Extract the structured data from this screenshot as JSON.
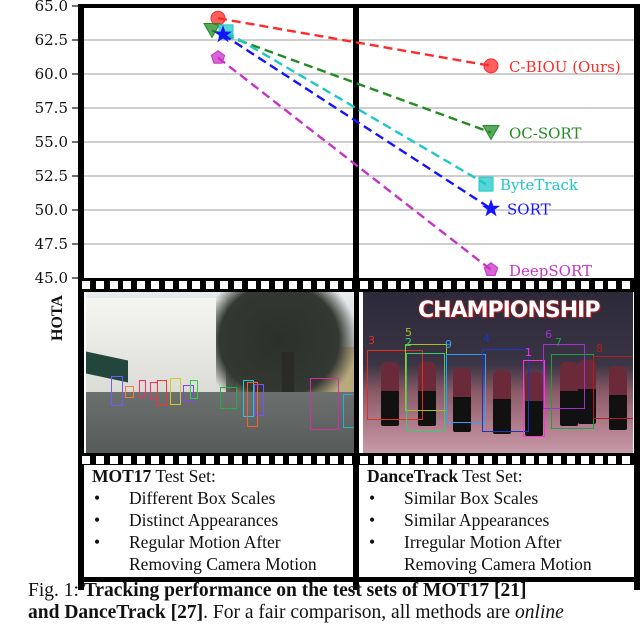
{
  "chart_data": {
    "type": "line",
    "title": "",
    "xlabel": "",
    "ylabel": "HOTA",
    "ylim": [
      45.0,
      65.0
    ],
    "yticks": [
      "65.0",
      "62.5",
      "60.0",
      "57.5",
      "55.0",
      "52.5",
      "50.0",
      "47.5",
      "45.0"
    ],
    "grid": true,
    "categories": [
      "MOT17",
      "DanceTrack"
    ],
    "series": [
      {
        "name": "C-BIOU (Ours)",
        "color": "#ff2a2a",
        "marker": "circle",
        "values": [
          64.1,
          60.6
        ]
      },
      {
        "name": "OC-SORT",
        "color": "#228b22",
        "marker": "triangle-down",
        "values": [
          63.2,
          55.7
        ]
      },
      {
        "name": "ByteTrack",
        "color": "#1fc8c8",
        "marker": "square",
        "values": [
          63.1,
          51.9
        ]
      },
      {
        "name": "SORT",
        "color": "#1414ff",
        "marker": "star",
        "values": [
          62.9,
          50.1
        ]
      },
      {
        "name": "DeepSORT",
        "color": "#c832c8",
        "marker": "pentagon",
        "values": [
          61.2,
          45.6
        ]
      }
    ]
  },
  "panels": {
    "mot17": {
      "title_bold": "MOT17",
      "title_rest": " Test Set:",
      "bullets": [
        "Different Box Scales",
        "Distinct Appearances",
        "Regular Motion After"
      ],
      "continuation": "Removing Camera Motion"
    },
    "dancetrack": {
      "title_bold": "DanceTrack",
      "title_rest": " Test Set:",
      "bullets": [
        "Similar Box Scales",
        "Similar Appearances",
        "Irregular Motion After"
      ],
      "continuation": "Removing Camera Motion",
      "banner": "CHAMPIONSHIP",
      "ids": [
        "3",
        "5",
        "2",
        "9",
        "4",
        "1",
        "6",
        "7",
        "8"
      ]
    },
    "bullet_glyph": "•"
  },
  "caption": {
    "prefix": "Fig. 1: ",
    "bold": "Tracking performance on the test sets of MOT17 [21]",
    "line2_bold": "and DanceTrack [27]",
    "line2_rest": ". For a fair comparison, all methods are ",
    "line2_italic": "online"
  }
}
